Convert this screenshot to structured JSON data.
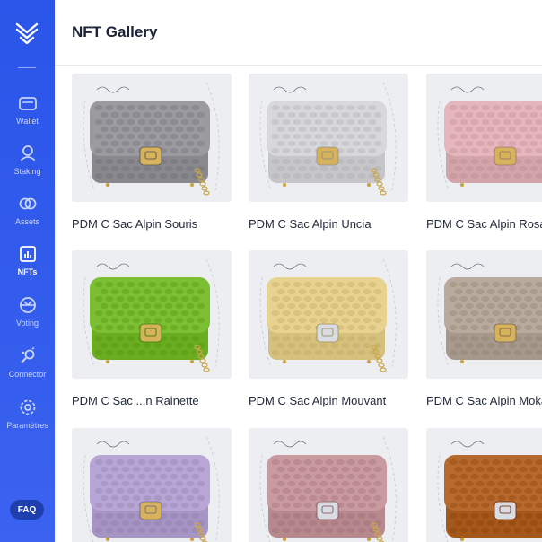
{
  "header": {
    "title": "NFT Gallery"
  },
  "sidebar": {
    "items": [
      {
        "label": "Wallet",
        "icon": "wallet-icon"
      },
      {
        "label": "Staking",
        "icon": "staking-icon"
      },
      {
        "label": "Assets",
        "icon": "assets-icon"
      },
      {
        "label": "NFTs",
        "icon": "nfts-icon",
        "active": true
      },
      {
        "label": "Voting",
        "icon": "voting-icon"
      },
      {
        "label": "Connector",
        "icon": "connector-icon"
      },
      {
        "label": "Paramètres",
        "icon": "settings-icon"
      }
    ],
    "faq_label": "FAQ"
  },
  "gallery": {
    "items": [
      {
        "name": "PDM C Sac Alpin Souris",
        "color": "#9a9a9f",
        "clasp": "gold"
      },
      {
        "name": "PDM C Sac Alpin Uncia",
        "color": "#d8d8db",
        "clasp": "gold"
      },
      {
        "name": "PDM C Sac Alpin Rosa",
        "color": "#e6b6bd",
        "clasp": "gold"
      },
      {
        "name": "PDM C Sac ...n Rainette",
        "color": "#7cbf33",
        "clasp": "gold"
      },
      {
        "name": "PDM C Sac Alpin Mouvant",
        "color": "#e7d38f",
        "clasp": "silver"
      },
      {
        "name": "PDM C Sac Alpin Moka",
        "color": "#b8aa9c",
        "clasp": "gold"
      },
      {
        "name": "",
        "color": "#b8a7d6",
        "clasp": "gold"
      },
      {
        "name": "",
        "color": "#c99aa0",
        "clasp": "silver"
      },
      {
        "name": "",
        "color": "#b76a2e",
        "clasp": "silver"
      }
    ]
  },
  "colors": {
    "sidebar": "#2f5bed",
    "accent": "#2a55e8"
  }
}
